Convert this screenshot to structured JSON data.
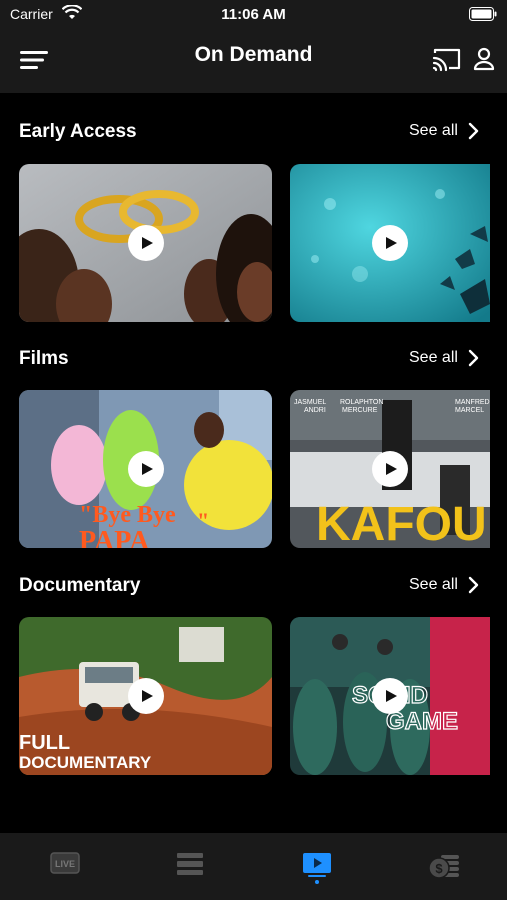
{
  "status_bar": {
    "carrier": "Carrier",
    "time": "11:06 AM"
  },
  "nav": {
    "title": "On Demand"
  },
  "sections": [
    {
      "title": "Early Access",
      "see_all": "See all",
      "items": [
        {
          "overlay_text": ""
        },
        {
          "overlay_text": ""
        }
      ]
    },
    {
      "title": "Films",
      "see_all": "See all",
      "items": [
        {
          "overlay_text": "\"Bye Bye",
          "overlay_text_2": "PAPA",
          "overlay_text_3": "\""
        },
        {
          "overlay_text": "KAFOU",
          "credit_1": "JASMUEL",
          "credit_1b": "ANDRI",
          "credit_2": "ROLAPHTON",
          "credit_2b": "MERCURE",
          "credit_3": "MANFRED",
          "credit_3b": "MARCEL"
        }
      ]
    },
    {
      "title": "Documentary",
      "see_all": "See all",
      "items": [
        {
          "overlay_text": "FULL",
          "overlay_text_2": "DOCUMENTARY"
        },
        {
          "overlay_text": "SQUID",
          "overlay_text_2": "GAME"
        }
      ]
    }
  ],
  "tabs": [
    {
      "name": "live",
      "label": "LIVE",
      "active": false
    },
    {
      "name": "guide",
      "active": false
    },
    {
      "name": "on-demand",
      "active": true
    },
    {
      "name": "pay-per-view",
      "active": false
    }
  ],
  "colors": {
    "accent": "#1e90ff",
    "background": "#000000",
    "bar": "#1a1a1a"
  }
}
